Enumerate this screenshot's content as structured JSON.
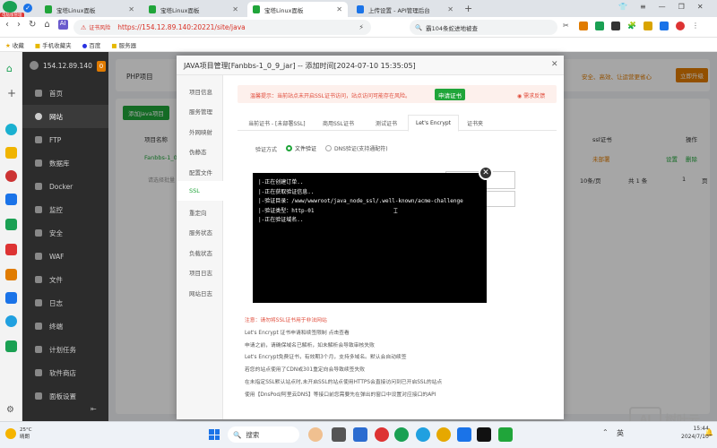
{
  "browser": {
    "tabs": [
      {
        "label": "宝塔Linux面板"
      },
      {
        "label": "宝塔Linux面板"
      },
      {
        "label": "宝塔Linux面板"
      },
      {
        "label": "上传设置 - API管理后台"
      }
    ],
    "security_label": "证书风险",
    "url": "https://154.12.89.140:20221/site/java",
    "search_text": "霸104条蛇进地被查",
    "bookmarks": [
      "收藏",
      "手机收藏夹",
      "百度",
      "服务器"
    ],
    "brand_badge": "电脑版管理"
  },
  "panel": {
    "server_ip": "154.12.89.140",
    "badge_count": "0",
    "nav": [
      "首页",
      "网站",
      "FTP",
      "数据库",
      "Docker",
      "监控",
      "安全",
      "WAF",
      "文件",
      "日志",
      "终端",
      "计划任务",
      "软件商店",
      "面板设置"
    ],
    "active_nav": "网站",
    "top_tab": "PHP项目",
    "add_button": "添加Java项目",
    "table_header_name": "项目名称",
    "project_row_name": "Fanbbs-1_0",
    "ssl_header": "ssl证书",
    "ops_header": "操作",
    "not_deployed": "未部署",
    "row_actions": [
      "设置",
      "删除"
    ],
    "pagination": {
      "per_page": "10条/页",
      "total": "共 1 条",
      "jump": "前往",
      "page": "1",
      "unit": "页"
    },
    "batch_placeholder": "请选择批量",
    "top_right_notice": "安全、高效、让运营更省心",
    "upgrade_button": "立即升级"
  },
  "modal": {
    "title": "JAVA项目管理[Fanbbs-1_0_9_jar] -- 添加时间[2024-07-10 15:35:05]",
    "nav": [
      "项目信息",
      "服务管理",
      "外网映射",
      "伪静态",
      "配置文件",
      "SSL",
      "重定向",
      "服务状态",
      "负载状态",
      "项目日志",
      "网站日志"
    ],
    "active_nav": "SSL",
    "warning_text": "温馨提示：当前站点未开启SSL证书访问，站点访问可能存在风险。",
    "apply_button": "申请证书",
    "feedback_link": "需求反馈",
    "ssl_tabs": [
      "当前证书 - [未部署SSL]",
      "商用SSL证书",
      "测试证书",
      "Let's Encrypt",
      "证书夹"
    ],
    "active_ssl_tab": "Let's Encrypt",
    "verify_label": "验证方式",
    "verify_options": [
      "文件验证",
      "DNS验证(支持通配符)"
    ],
    "notes_title": "注意：请勿将SSL证书用于非法网站",
    "notes": [
      "Let's Encrypt 证书申请和续签限制 点击查看",
      "申请之前，请确保域名已解析，如未解析会导致审核失败",
      "Let's Encrypt免费证书，有效期3个月，支持多域名。默认会自动续签",
      "若您的站点使用了CDN或301重定向会导致续签失败",
      "在未指定SSL默认站点时,未开启SSL的站点使用HTTPS会直接访问到已开启SSL的站点",
      "使用【DnsPod/阿里云DNS】等接口前您需要先在弹出的窗口中设置对应接口的API"
    ]
  },
  "terminal": {
    "lines": [
      "|-正在创建订单..",
      "|-正在获取验证信息..",
      "|-验证目录：/www/wwwroot/java_node_ssl/.well-known/acme-challenge",
      "|-验证类型：http-01",
      "|-正在验证域名.."
    ]
  },
  "taskbar": {
    "weather_temp": "25°C",
    "weather_desc": "晴朗",
    "search_placeholder": "搜索",
    "ime": "英",
    "time": "15:44",
    "date": "2024/7/10",
    "watermark": "树叶云"
  },
  "colors": {
    "accent": "#20a53a",
    "sidebar": "#2c2c2c",
    "warning": "#e04b3a"
  }
}
